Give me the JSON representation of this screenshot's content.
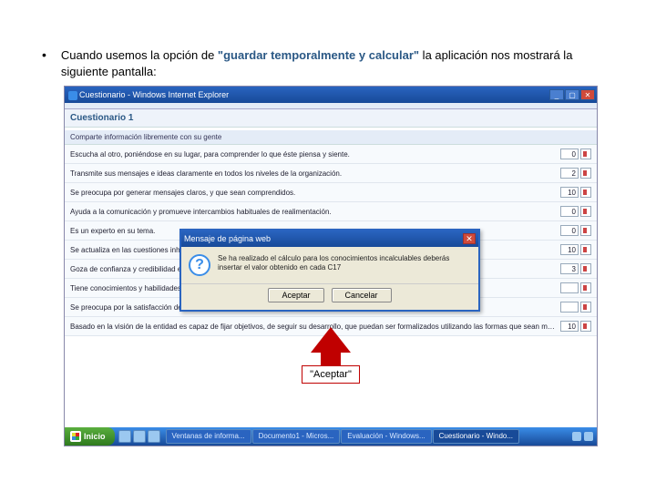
{
  "bullet_text_pre": "Cuando usemos la opción de ",
  "bullet_text_quote": "\"guardar temporalmente y calcular\"",
  "bullet_text_post": " la aplicación nos mostrará la siguiente pantalla:",
  "window": {
    "title": "Cuestionario - Windows Internet Explorer",
    "page_title": "Cuestionario 1",
    "section_header": "Comparte información libremente con su gente",
    "rows": [
      {
        "text": "Escucha al otro, poniéndose en su lugar, para comprender lo que éste piensa y siente.",
        "value": "0"
      },
      {
        "text": "Transmite sus mensajes e ideas claramente en todos los niveles de la organización.",
        "value": "2"
      },
      {
        "text": "Se preocupa por generar mensajes claros, y que sean comprendidos.",
        "value": "10"
      },
      {
        "text": "Ayuda a la comunicación y promueve intercambios habituales de realimentación.",
        "value": "0"
      },
      {
        "text": "Es un experto en su tema.",
        "value": "0"
      },
      {
        "text": "Se actualiza en las cuestiones inherentes.",
        "value": "10"
      },
      {
        "text": "Goza de confianza y credibilidad en las demás áreas de la organización y por los usuarios.",
        "value": "3"
      },
      {
        "text": "Tiene conocimientos y habilidades para realizar un correcto manejo de los recursos.",
        "value": ""
      },
      {
        "text": "Se preocupa por la satisfacción de las expectativas de sus clientes (internos o externos).",
        "value": ""
      },
      {
        "text": "Basado en la visión de la entidad es capaz de fijar objetivos, de seguir su desarrollo, que puedan ser formalizados utilizando las formas que sean más adecuadas.",
        "value": "10"
      }
    ]
  },
  "dialog": {
    "title": "Mensaje de página web",
    "message": "Se ha realizado el cálculo para los conocimientos incalculables deberás insertar el valor obtenido en cada C17",
    "accept": "Aceptar",
    "cancel": "Cancelar"
  },
  "callout": "\"Aceptar\"",
  "taskbar": {
    "start": "Inicio",
    "tasks": [
      "Ventanas de informa...",
      "Documento1 - Micros...",
      "Evaluación - Windows...",
      "Cuestionario - Windo..."
    ]
  }
}
